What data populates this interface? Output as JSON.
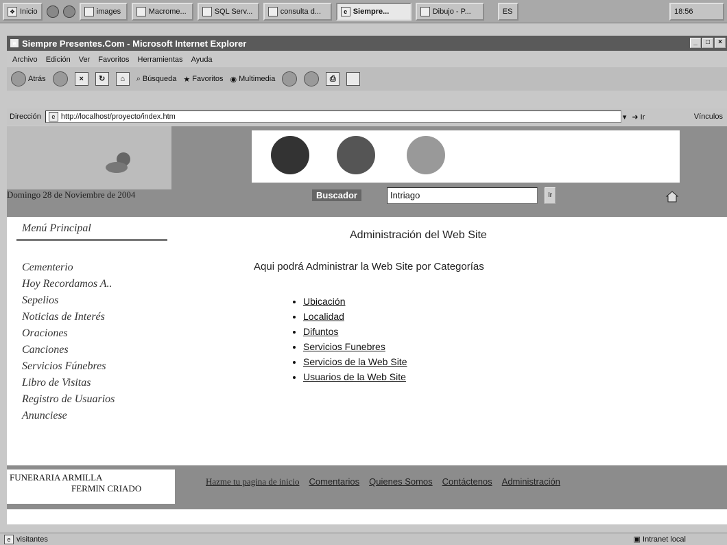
{
  "taskbar": {
    "start_label": "Inicio",
    "buttons": [
      "images",
      "Macrome...",
      "SQL Serv...",
      "consulta d...",
      "Siempre...",
      "Dibujo - P..."
    ],
    "lang": "ES",
    "clock": "18:56"
  },
  "window": {
    "title": "Siempre Presentes.Com - Microsoft Internet Explorer",
    "min": "_",
    "max": "□",
    "close": "×"
  },
  "menubar": [
    "Archivo",
    "Edición",
    "Ver",
    "Favoritos",
    "Herramientas",
    "Ayuda"
  ],
  "toolbar": {
    "back": "Atrás",
    "search": "Búsqueda",
    "favorites": "Favoritos",
    "multimedia": "Multimedia"
  },
  "address": {
    "label": "Dirección",
    "url": "http://localhost/proyecto/index.htm",
    "go": "Ir",
    "links": "Vínculos"
  },
  "header": {
    "date": "Domingo 28 de Noviembre de 2004",
    "search_label": "Buscador",
    "search_value": "Intriago",
    "search_go": "Ir"
  },
  "sidebar": {
    "title": "Menú Principal",
    "items": [
      "Cementerio",
      "Hoy Recordamos A..",
      "Sepelios",
      "Noticias de Interés",
      "Oraciones",
      "Canciones",
      "Servicios Fúnebres",
      "Libro de Visitas",
      "Registro de Usuarios",
      "Anunciese"
    ]
  },
  "main": {
    "title": "Administración del Web Site",
    "description": "Aqui podrá Administrar la Web Site por Categorías",
    "links": [
      "Ubicación",
      "Localidad",
      "Difuntos",
      "Servicios Funebres",
      "Servicios de la Web Site",
      "Usuarios de la Web Site"
    ]
  },
  "footer": {
    "brand_line1": "FUNERARIA ARMILLA",
    "brand_line2": "FERMIN CRIADO",
    "links": [
      "Hazme tu pagina de inicio",
      "Comentarios",
      "Quienes Somos",
      "Contáctenos",
      "Administración"
    ]
  },
  "status": {
    "text": "visitantes",
    "zone": "Intranet local"
  },
  "colors": {
    "titlebar": "#5a5a5a",
    "banner": "#8e8e8e",
    "footer": "#8c8c8c"
  }
}
